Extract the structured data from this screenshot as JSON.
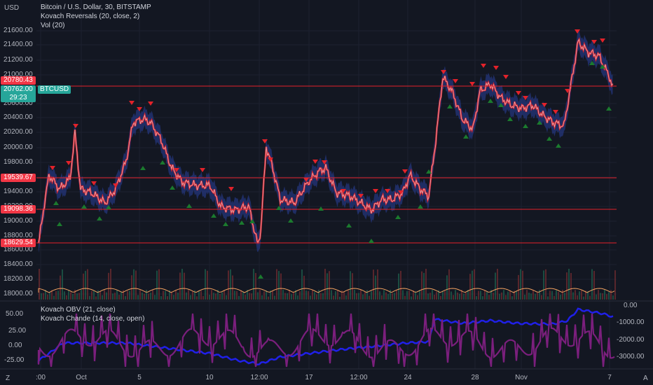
{
  "currency": "USD",
  "legend": {
    "title": "Bitcoin / U.S. Dollar, 30, BITSTAMP",
    "indicator1": "Kovach Reversals (20, close, 2)",
    "indicator2": "Vol (20)"
  },
  "price_axis": {
    "ticks": [
      "21600.00",
      "21400.00",
      "21200.00",
      "21000.00",
      "20600.00",
      "20400.00",
      "20200.00",
      "20000.00",
      "19800.00",
      "19600.00",
      "19400.00",
      "19200.00",
      "19000.00",
      "18800.00",
      "18600.00",
      "18400.00",
      "18200.00",
      "18000.00"
    ]
  },
  "level_tags": [
    {
      "text": "20780.43",
      "color": "#f23645"
    },
    {
      "text": "19539.67",
      "color": "#f23645"
    },
    {
      "text": "19098.36",
      "color": "#f23645"
    },
    {
      "text": "18629.54",
      "color": "#f23645"
    }
  ],
  "last_price": {
    "value": "20762.00",
    "countdown": "29:23",
    "symbol": "BTCUSD",
    "color": "#26a69a"
  },
  "lower_pane": {
    "legend1": "Kovach OBV (21, close)",
    "legend2": "Kovach Chande (14, close, open)",
    "left_ticks": [
      "50.00",
      "25.00",
      "0.00",
      "-25.00"
    ],
    "right_ticks": [
      "0.00",
      "-1000.00",
      "-2000.00",
      "-3000.00"
    ]
  },
  "time_axis": {
    "ticks": [
      ":00",
      "Oct",
      "5",
      "10",
      "12:00",
      "17",
      "12:00",
      "24",
      "28",
      "Nov",
      "7"
    ]
  },
  "corner_buttons": {
    "left": "Z",
    "right": "A"
  },
  "colors": {
    "background": "#131722",
    "up": "#1b7a2e",
    "down": "#e3222a",
    "band": "#2a3f9a",
    "obv": "#2020e8",
    "chande": "#7b1f7d",
    "volume_ma": "#f0a060"
  }
}
